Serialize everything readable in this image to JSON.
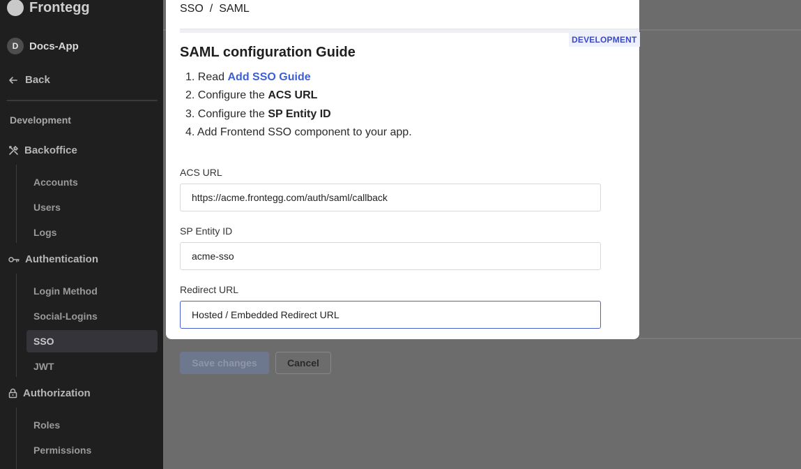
{
  "sidebar": {
    "brand": "Frontegg",
    "app_initial": "D",
    "app_name": "Docs-App",
    "back_label": "Back",
    "environment": "Development",
    "sections": [
      {
        "label": "Backoffice",
        "icon": "tools-icon",
        "items": [
          "Accounts",
          "Users",
          "Logs"
        ]
      },
      {
        "label": "Authentication",
        "icon": "key-icon",
        "items": [
          "Login Method",
          "Social-Logins",
          "SSO",
          "JWT"
        ]
      },
      {
        "label": "Authorization",
        "icon": "lock-icon",
        "items": [
          "Roles",
          "Permissions"
        ]
      }
    ],
    "active_item": "SSO"
  },
  "modal": {
    "breadcrumb": [
      "SSO",
      "/",
      "SAML"
    ],
    "environment_tag": "DEVELOPMENT",
    "title": "SAML configuration Guide",
    "steps": [
      {
        "num": "1.",
        "prefix": "Read ",
        "link": "Add SSO Guide"
      },
      {
        "num": "2.",
        "prefix": "Configure the ",
        "bold": "ACS URL"
      },
      {
        "num": "3.",
        "prefix": "Configure the ",
        "bold": "SP Entity ID"
      },
      {
        "num": "4.",
        "prefix": "Add Frontend SSO component to your app."
      }
    ],
    "fields": {
      "acs_url": {
        "label": "ACS URL",
        "value": "https://acme.frontegg.com/auth/saml/callback"
      },
      "sp_entity_id": {
        "label": "SP Entity ID",
        "value": "acme-sso"
      },
      "redirect_url": {
        "label": "Redirect URL",
        "value": "Hosted / Embedded Redirect URL"
      }
    }
  },
  "footer": {
    "save_label": "Save changes",
    "cancel_label": "Cancel"
  },
  "colors": {
    "sidebar_bg": "#1f1f1f",
    "overlay_bg": "#6c6c6c",
    "accent": "#3c5fd8",
    "focus_border": "#4a5fd1"
  }
}
